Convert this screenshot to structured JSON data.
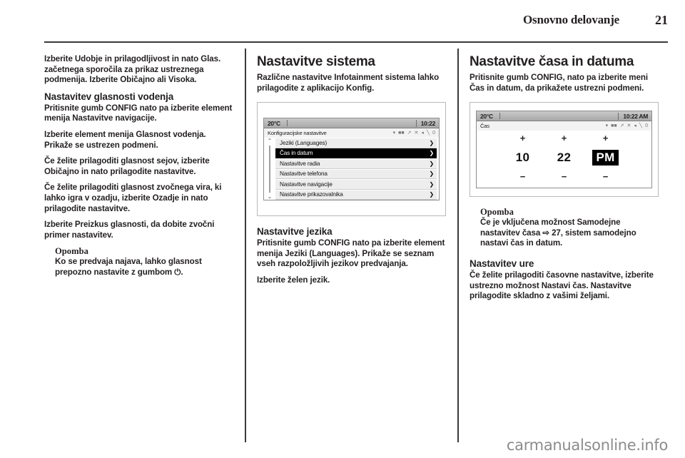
{
  "header": {
    "title": "Osnovno delovanje",
    "page_number": "21"
  },
  "left_column": {
    "intro": "Izberite Udobje in prilagodljivost in nato Glas. začetnega sporočila za prikaz ustreznega podmenija. Izberite Običajno ali Visoka.",
    "section1_title": "Nastavitev glasnosti vodenja",
    "section1_p1": "Pritisnite gumb CONFIG nato pa izberite element menija Nastavitve navigacije.",
    "section1_p2": "Izberite element menija Glasnost vodenja. Prikaže se ustrezen podmeni.",
    "section1_p3": "Če želite prilagoditi glasnost sejov, izberite Običajno in nato prilagodite nastavitve.",
    "section1_p4": "Če želite prilagoditi glasnost zvočnega vira, ki lahko igra v ozadju, izberite Ozadje in nato prilagodite nastavitve.",
    "section1_p5": "Izberite Preizkus glasnosti, da dobite zvočni primer nastavitev.",
    "note_title": "Opomba",
    "note_body": "Ko se predvaja najava, lahko glasnost prepozno nastavite z gumbom ⏻."
  },
  "mid_column": {
    "heading": "Nastavitve sistema",
    "intro": "Različne nastavitve Infotainment sistema lahko prilagodite z aplikacijo Konfig.",
    "section_title": "Nastavitve jezika",
    "section_p1": "Pritisnite gumb CONFIG nato pa izberite element menija Jeziki (Languages). Prikaže se seznam vseh razpoložljivih jezikov predvajanja.",
    "section_p2": "Izberite želen jezik."
  },
  "right_column": {
    "heading": "Nastavitve časa in datuma",
    "intro": "Pritisnite gumb CONFIG, nato pa izberite meni Čas in datum, da prikažete ustrezni podmeni.",
    "note_title": "Opomba",
    "note_body": "Če je vključena možnost Samodejne nastavitev časa ⇨ 27, sistem samodejno nastavi čas in datum.",
    "section_title": "Nastavitev ure",
    "section_p1": "Če želite prilagoditi časovne nastavitve, izberite ustrezno možnost Nastavi čas. Nastavitve prilagodite skladno z vašimi željami."
  },
  "device_config": {
    "status_temp": "20°C",
    "status_clock": "10:22",
    "title": "Konfiguracijske nastavitve",
    "status_icons": [
      "wifi-icon",
      "media-icon",
      "mute-icon",
      "shuffle-icon",
      "speaker-off-icon",
      "phone-icon",
      "bluetooth-icon"
    ],
    "scroll_up": "⌃",
    "scroll_down": "⌄",
    "chevron": "❯",
    "items": [
      {
        "label": "Jeziki (Languages)",
        "selected": false
      },
      {
        "label": "Čas in datum",
        "selected": true
      },
      {
        "label": "Nastavitve radia",
        "selected": false
      },
      {
        "label": "Nastavitve telefona",
        "selected": false
      },
      {
        "label": "Nastavitve navigacije",
        "selected": false
      },
      {
        "label": "Nastavitve prikazovalnika",
        "selected": false
      }
    ]
  },
  "device_time": {
    "status_temp": "20°C",
    "status_clock": "10:22 AM",
    "title": "Čas",
    "status_icons": [
      "wifi-icon",
      "media-icon",
      "mute-icon",
      "shuffle-icon",
      "speaker-off-icon",
      "phone-icon",
      "bluetooth-icon"
    ],
    "plus": "+",
    "minus": "−",
    "fields": [
      {
        "value": "10",
        "highlighted": false
      },
      {
        "value": "22",
        "highlighted": false
      },
      {
        "value": "PM",
        "highlighted": true
      }
    ]
  },
  "footer": {
    "watermark": "carmanualsonline.info"
  },
  "colors": {
    "ink": "#231f20",
    "rule": "#3a3a3a",
    "watermark": "#8c8c8c"
  }
}
